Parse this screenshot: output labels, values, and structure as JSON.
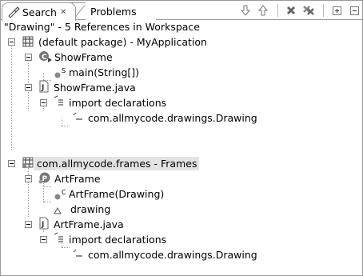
{
  "tabs": [
    {
      "label": "Search",
      "close": "✕",
      "active": true
    },
    {
      "label": "Problems",
      "active": false
    }
  ],
  "toolbar": {
    "buttons": [
      "next-match-icon",
      "previous-match-icon",
      "remove-selected-icon",
      "remove-all-icon",
      "expand-all-icon",
      "collapse-all-icon"
    ]
  },
  "results_header": "\"Drawing\" - 5 References in Workspace",
  "tree": [
    {
      "label": "(default package) - MyApplication",
      "icon": "package-icon"
    },
    {
      "label": "ShowFrame",
      "icon": "class-icon"
    },
    {
      "label": "main(String[])",
      "icon": "method-icon",
      "modifier": "S"
    },
    {
      "label": "ShowFrame.java",
      "icon": "java-file-icon"
    },
    {
      "label": "import declarations",
      "icon": "imports-icon"
    },
    {
      "label": "com.allmycode.drawings.Drawing",
      "icon": "import-icon"
    },
    {
      "label": "com.allmycode.frames - Frames",
      "icon": "package-icon",
      "selected": true
    },
    {
      "label": "ArtFrame",
      "icon": "class-icon"
    },
    {
      "label": "ArtFrame(Drawing)",
      "icon": "constructor-icon",
      "modifier": "C"
    },
    {
      "label": "drawing",
      "icon": "field-icon"
    },
    {
      "label": "ArtFrame.java",
      "icon": "java-file-icon"
    },
    {
      "label": "import declarations",
      "icon": "imports-icon"
    },
    {
      "label": "com.allmycode.drawings.Drawing",
      "icon": "import-icon"
    }
  ],
  "colors": {
    "selection": "#e3e3e3",
    "border": "#9a9a9a"
  }
}
